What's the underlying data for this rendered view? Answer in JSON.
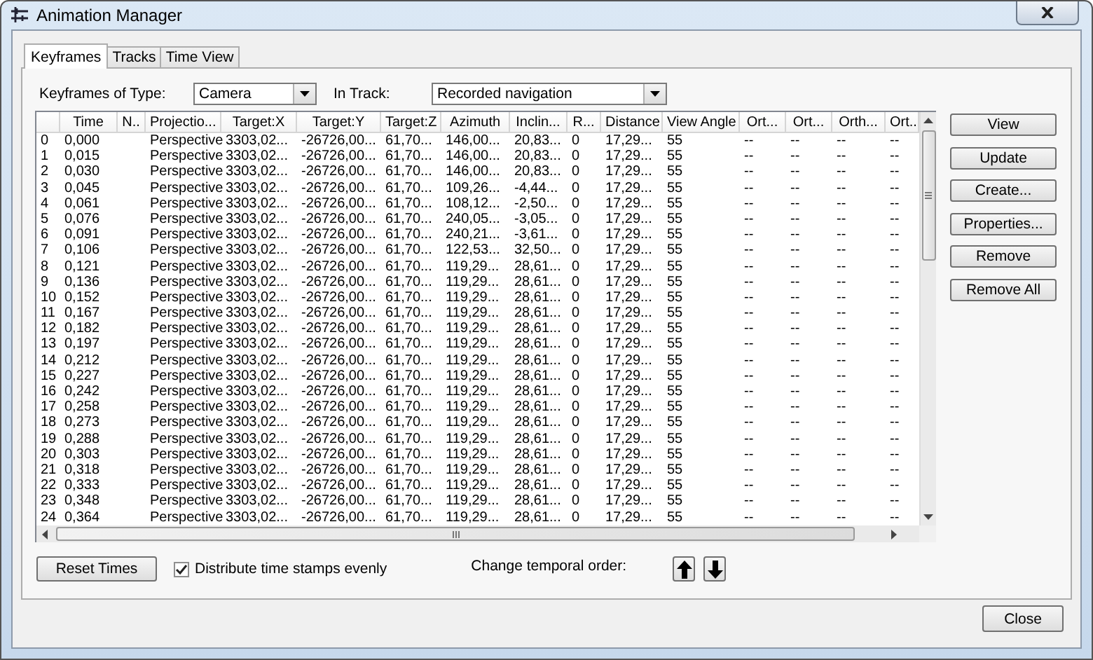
{
  "window": {
    "title": "Animation Manager"
  },
  "tabs": [
    {
      "label": "Keyframes",
      "selected": true
    },
    {
      "label": "Tracks",
      "selected": false
    },
    {
      "label": "Time View",
      "selected": false
    }
  ],
  "filters": [
    {
      "label": "Keyframes of Type:",
      "value": "Camera"
    },
    {
      "label": "In Track:",
      "value": "Recorded navigation"
    }
  ],
  "table": {
    "columns": [
      "Time",
      "N..",
      "Projectio...",
      "Target:X",
      "Target:Y",
      "Target:Z",
      "Azimuth",
      "Inclin...",
      "R...",
      "Distance",
      "View Angle",
      "Ort...",
      "Ort...",
      "Orth...",
      "Ort..."
    ],
    "rows": [
      {
        "index": "0",
        "cells": [
          "0,000",
          null,
          "Perspective",
          "3303,02...",
          "-26726,00...",
          "61,70...",
          "146,00...",
          "20,83...",
          "0",
          "17,29...",
          "55",
          "--",
          "--",
          "--",
          "--"
        ]
      },
      {
        "index": "1",
        "cells": [
          "0,015",
          null,
          "Perspective",
          "3303,02...",
          "-26726,00...",
          "61,70...",
          "146,00...",
          "20,83...",
          "0",
          "17,29...",
          "55",
          "--",
          "--",
          "--",
          "--"
        ]
      },
      {
        "index": "2",
        "cells": [
          "0,030",
          null,
          "Perspective",
          "3303,02...",
          "-26726,00...",
          "61,70...",
          "146,00...",
          "20,83...",
          "0",
          "17,29...",
          "55",
          "--",
          "--",
          "--",
          "--"
        ]
      },
      {
        "index": "3",
        "cells": [
          "0,045",
          null,
          "Perspective",
          "3303,02...",
          "-26726,00...",
          "61,70...",
          "109,26...",
          "-4,44...",
          "0",
          "17,29...",
          "55",
          "--",
          "--",
          "--",
          "--"
        ]
      },
      {
        "index": "4",
        "cells": [
          "0,061",
          null,
          "Perspective",
          "3303,02...",
          "-26726,00...",
          "61,70...",
          "108,12...",
          "-2,50...",
          "0",
          "17,29...",
          "55",
          "--",
          "--",
          "--",
          "--"
        ]
      },
      {
        "index": "5",
        "cells": [
          "0,076",
          null,
          "Perspective",
          "3303,02...",
          "-26726,00...",
          "61,70...",
          "240,05...",
          "-3,05...",
          "0",
          "17,29...",
          "55",
          "--",
          "--",
          "--",
          "--"
        ]
      },
      {
        "index": "6",
        "cells": [
          "0,091",
          null,
          "Perspective",
          "3303,02...",
          "-26726,00...",
          "61,70...",
          "240,21...",
          "-3,61...",
          "0",
          "17,29...",
          "55",
          "--",
          "--",
          "--",
          "--"
        ]
      },
      {
        "index": "7",
        "cells": [
          "0,106",
          null,
          "Perspective",
          "3303,02...",
          "-26726,00...",
          "61,70...",
          "122,53...",
          "32,50...",
          "0",
          "17,29...",
          "55",
          "--",
          "--",
          "--",
          "--"
        ]
      },
      {
        "index": "8",
        "cells": [
          "0,121",
          null,
          "Perspective",
          "3303,02...",
          "-26726,00...",
          "61,70...",
          "119,29...",
          "28,61...",
          "0",
          "17,29...",
          "55",
          "--",
          "--",
          "--",
          "--"
        ]
      },
      {
        "index": "9",
        "cells": [
          "0,136",
          null,
          "Perspective",
          "3303,02...",
          "-26726,00...",
          "61,70...",
          "119,29...",
          "28,61...",
          "0",
          "17,29...",
          "55",
          "--",
          "--",
          "--",
          "--"
        ]
      },
      {
        "index": "10",
        "cells": [
          "0,152",
          null,
          "Perspective",
          "3303,02...",
          "-26726,00...",
          "61,70...",
          "119,29...",
          "28,61...",
          "0",
          "17,29...",
          "55",
          "--",
          "--",
          "--",
          "--"
        ]
      },
      {
        "index": "11",
        "cells": [
          "0,167",
          null,
          "Perspective",
          "3303,02...",
          "-26726,00...",
          "61,70...",
          "119,29...",
          "28,61...",
          "0",
          "17,29...",
          "55",
          "--",
          "--",
          "--",
          "--"
        ]
      },
      {
        "index": "12",
        "cells": [
          "0,182",
          null,
          "Perspective",
          "3303,02...",
          "-26726,00...",
          "61,70...",
          "119,29...",
          "28,61...",
          "0",
          "17,29...",
          "55",
          "--",
          "--",
          "--",
          "--"
        ]
      },
      {
        "index": "13",
        "cells": [
          "0,197",
          null,
          "Perspective",
          "3303,02...",
          "-26726,00...",
          "61,70...",
          "119,29...",
          "28,61...",
          "0",
          "17,29...",
          "55",
          "--",
          "--",
          "--",
          "--"
        ]
      },
      {
        "index": "14",
        "cells": [
          "0,212",
          null,
          "Perspective",
          "3303,02...",
          "-26726,00...",
          "61,70...",
          "119,29...",
          "28,61...",
          "0",
          "17,29...",
          "55",
          "--",
          "--",
          "--",
          "--"
        ]
      },
      {
        "index": "15",
        "cells": [
          "0,227",
          null,
          "Perspective",
          "3303,02...",
          "-26726,00...",
          "61,70...",
          "119,29...",
          "28,61...",
          "0",
          "17,29...",
          "55",
          "--",
          "--",
          "--",
          "--"
        ]
      },
      {
        "index": "16",
        "cells": [
          "0,242",
          null,
          "Perspective",
          "3303,02...",
          "-26726,00...",
          "61,70...",
          "119,29...",
          "28,61...",
          "0",
          "17,29...",
          "55",
          "--",
          "--",
          "--",
          "--"
        ]
      },
      {
        "index": "17",
        "cells": [
          "0,258",
          null,
          "Perspective",
          "3303,02...",
          "-26726,00...",
          "61,70...",
          "119,29...",
          "28,61...",
          "0",
          "17,29...",
          "55",
          "--",
          "--",
          "--",
          "--"
        ]
      },
      {
        "index": "18",
        "cells": [
          "0,273",
          null,
          "Perspective",
          "3303,02...",
          "-26726,00...",
          "61,70...",
          "119,29...",
          "28,61...",
          "0",
          "17,29...",
          "55",
          "--",
          "--",
          "--",
          "--"
        ]
      },
      {
        "index": "19",
        "cells": [
          "0,288",
          null,
          "Perspective",
          "3303,02...",
          "-26726,00...",
          "61,70...",
          "119,29...",
          "28,61...",
          "0",
          "17,29...",
          "55",
          "--",
          "--",
          "--",
          "--"
        ]
      },
      {
        "index": "20",
        "cells": [
          "0,303",
          null,
          "Perspective",
          "3303,02...",
          "-26726,00...",
          "61,70...",
          "119,29...",
          "28,61...",
          "0",
          "17,29...",
          "55",
          "--",
          "--",
          "--",
          "--"
        ]
      },
      {
        "index": "21",
        "cells": [
          "0,318",
          null,
          "Perspective",
          "3303,02...",
          "-26726,00...",
          "61,70...",
          "119,29...",
          "28,61...",
          "0",
          "17,29...",
          "55",
          "--",
          "--",
          "--",
          "--"
        ]
      },
      {
        "index": "22",
        "cells": [
          "0,333",
          null,
          "Perspective",
          "3303,02...",
          "-26726,00...",
          "61,70...",
          "119,29...",
          "28,61...",
          "0",
          "17,29...",
          "55",
          "--",
          "--",
          "--",
          "--"
        ]
      },
      {
        "index": "23",
        "cells": [
          "0,348",
          null,
          "Perspective",
          "3303,02...",
          "-26726,00...",
          "61,70...",
          "119,29...",
          "28,61...",
          "0",
          "17,29...",
          "55",
          "--",
          "--",
          "--",
          "--"
        ]
      },
      {
        "index": "24",
        "cells": [
          "0,364",
          null,
          "Perspective",
          "3303,02...",
          "-26726,00...",
          "61,70...",
          "119,29...",
          "28,61...",
          "0",
          "17,29...",
          "55",
          "--",
          "--",
          "--",
          "--"
        ]
      }
    ]
  },
  "side_buttons": [
    "View",
    "Update",
    "Create...",
    "Properties...",
    "Remove",
    "Remove All"
  ],
  "reset_button": "Reset Times",
  "distribute": {
    "label": "Distribute time stamps evenly",
    "checked": true
  },
  "order_label": "Change temporal order:",
  "close_button": "Close"
}
